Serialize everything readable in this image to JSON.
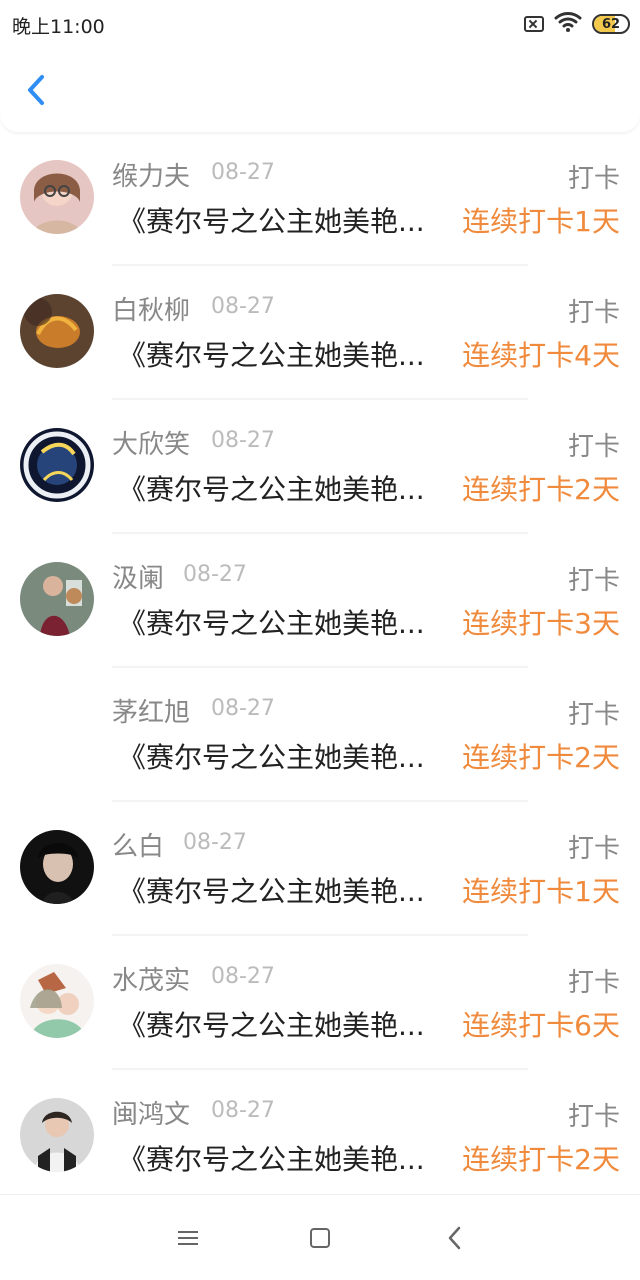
{
  "status_bar": {
    "time": "晚上11:00",
    "battery": "62",
    "icons": [
      "no-sim-icon",
      "wifi-icon",
      "battery-icon"
    ]
  },
  "header": {
    "back_icon": "back-icon"
  },
  "colors": {
    "accent_blue": "#2f8df3",
    "streak_orange": "#f08a3c",
    "muted_text": "#888888",
    "date_text": "#bbbbbb"
  },
  "items": [
    {
      "name": "缑力夫",
      "date": "08-27",
      "tag": "打卡",
      "title": "《赛尔号之公主她美艳...",
      "streak": "连续打卡1天"
    },
    {
      "name": "白秋柳",
      "date": "08-27",
      "tag": "打卡",
      "title": "《赛尔号之公主她美艳...",
      "streak": "连续打卡4天"
    },
    {
      "name": "大欣笑",
      "date": "08-27",
      "tag": "打卡",
      "title": "《赛尔号之公主她美艳...",
      "streak": "连续打卡2天"
    },
    {
      "name": "汲阑",
      "date": "08-27",
      "tag": "打卡",
      "title": "《赛尔号之公主她美艳...",
      "streak": "连续打卡3天"
    },
    {
      "name": "茅红旭",
      "date": "08-27",
      "tag": "打卡",
      "title": "《赛尔号之公主她美艳...",
      "streak": "连续打卡2天"
    },
    {
      "name": "么白",
      "date": "08-27",
      "tag": "打卡",
      "title": "《赛尔号之公主她美艳...",
      "streak": "连续打卡1天"
    },
    {
      "name": "水茂实",
      "date": "08-27",
      "tag": "打卡",
      "title": "《赛尔号之公主她美艳...",
      "streak": "连续打卡6天"
    },
    {
      "name": "闽鸿文",
      "date": "08-27",
      "tag": "打卡",
      "title": "《赛尔号之公主她美艳...",
      "streak": "连续打卡2天"
    }
  ],
  "nav": {
    "icons": [
      "menu-icon",
      "home-icon",
      "back-icon"
    ]
  }
}
